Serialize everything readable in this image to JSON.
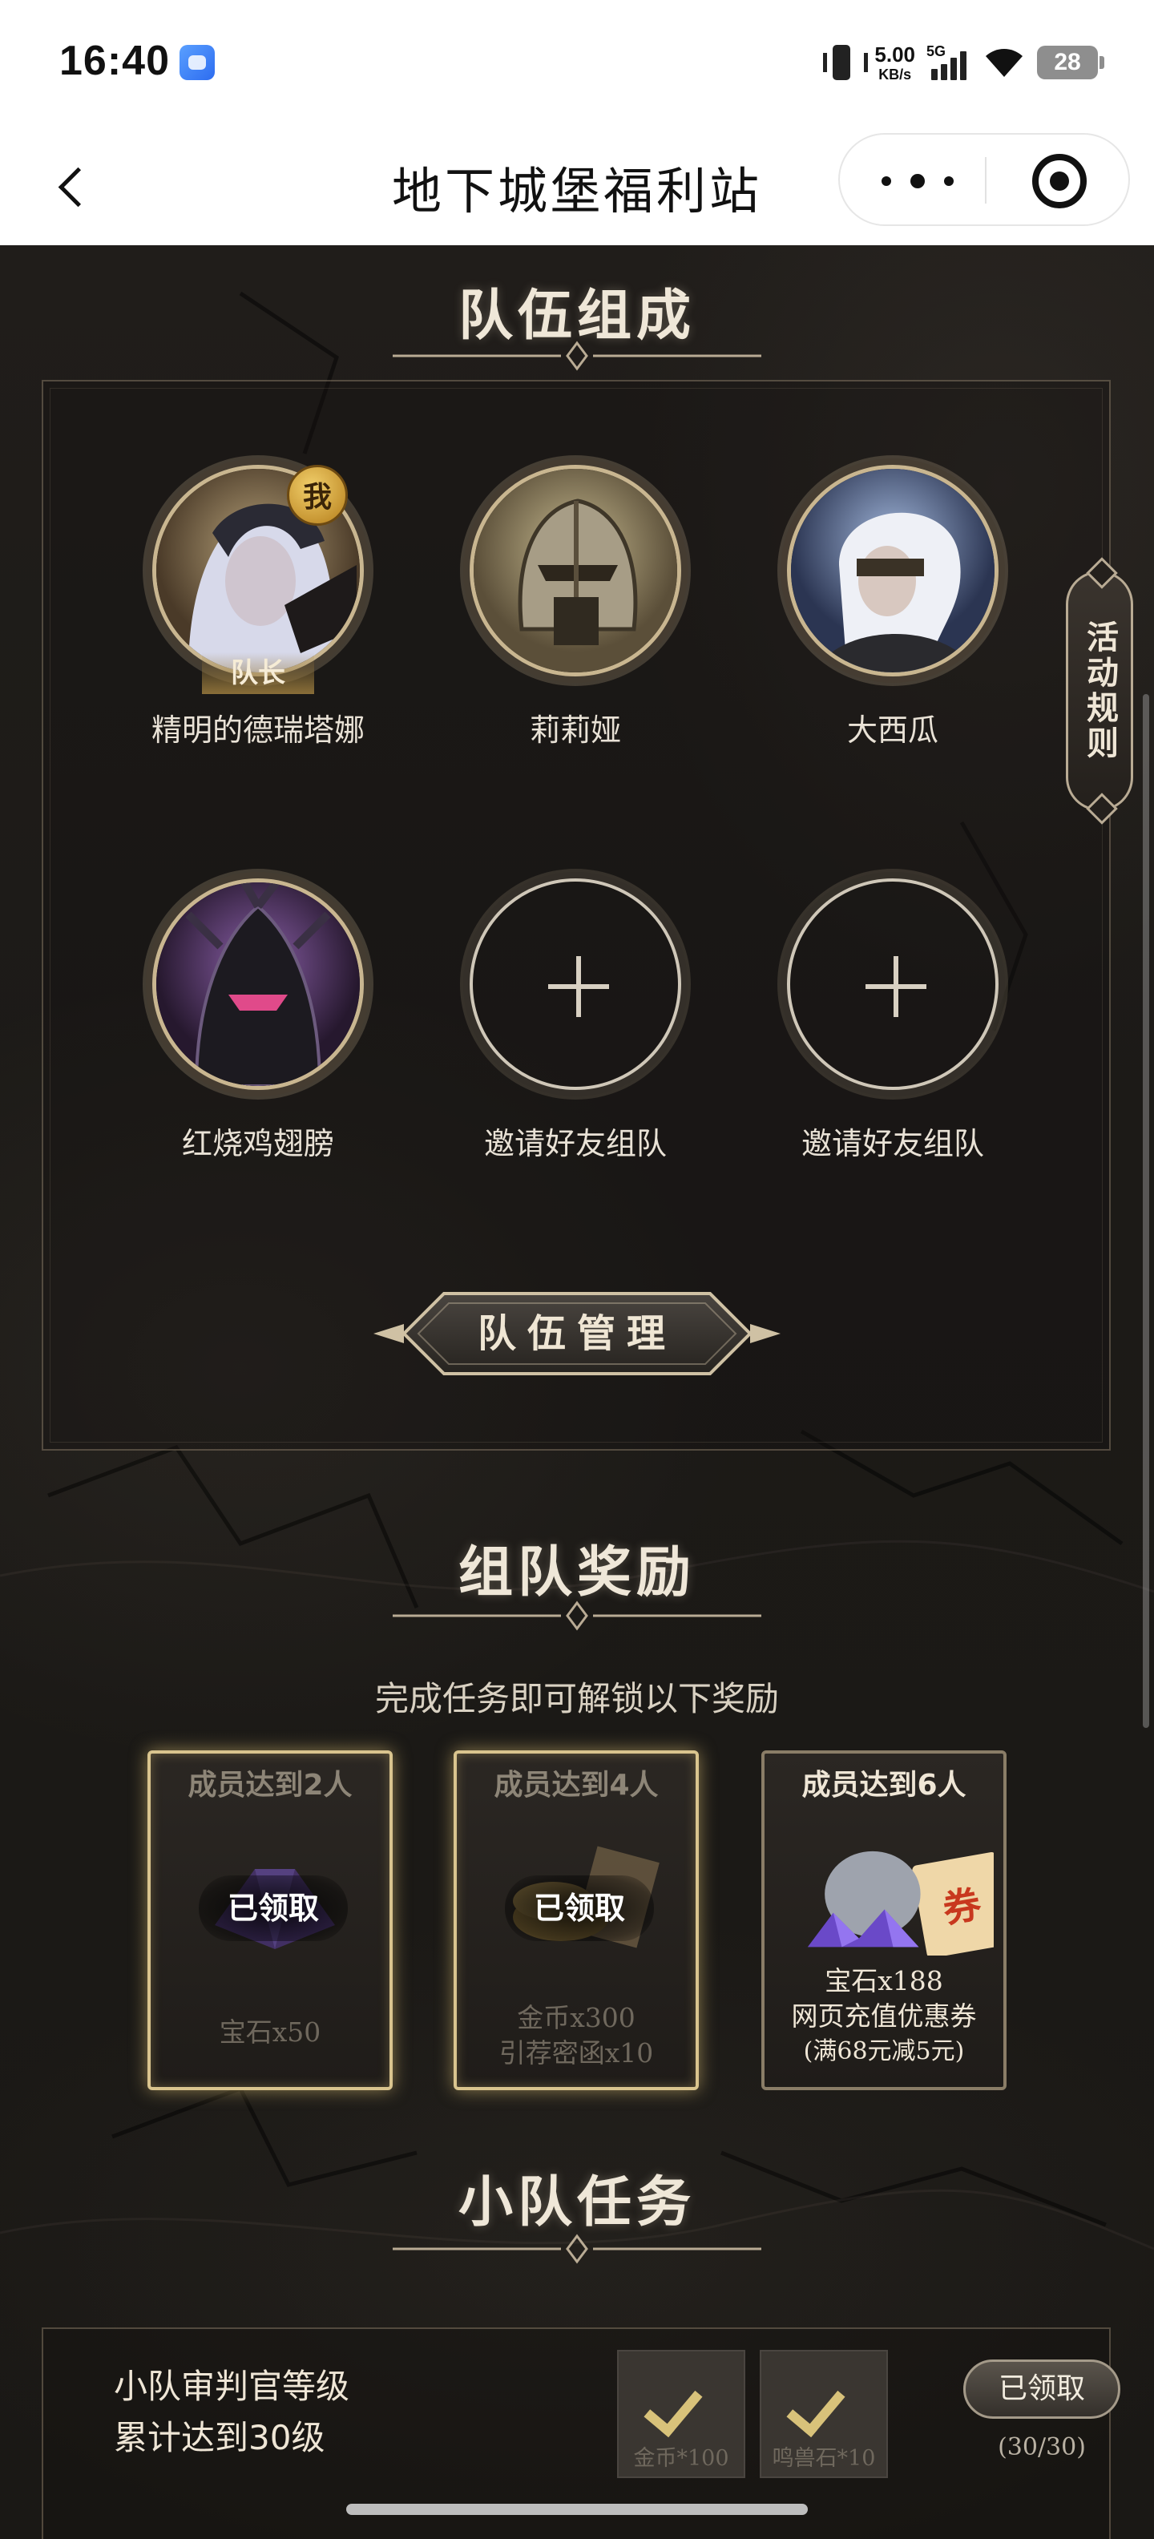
{
  "status_bar": {
    "time": "16:40",
    "net_speed": "5.00",
    "net_unit": "KB/s",
    "signal_label": "5G",
    "battery": "28",
    "icons": [
      "app-icon",
      "vibrate-icon",
      "signal-icon",
      "wifi-icon",
      "battery-icon"
    ]
  },
  "nav": {
    "title": "地下城堡福利站",
    "icons": [
      "back-icon",
      "more-icon",
      "close-mini-icon"
    ]
  },
  "rules_tab": "活动规则",
  "team": {
    "title": "队伍组成",
    "me_badge": "我",
    "leader_badge": "队长",
    "members": [
      {
        "name": "精明的德瑞塔娜",
        "avatar": "silver-haired-woman"
      },
      {
        "name": "莉莉娅",
        "avatar": "knight-helmet"
      },
      {
        "name": "大西瓜",
        "avatar": "masked-white-haired-warrior"
      },
      {
        "name": "红烧鸡翅膀",
        "avatar": "dark-armored-knight"
      }
    ],
    "invite_label": "邀请好友组队",
    "manage_button": "队伍管理"
  },
  "rewards": {
    "title": "组队奖励",
    "subtitle": "完成任务即可解锁以下奖励",
    "claimed_label": "已领取",
    "cards": [
      {
        "title": "成员达到2人",
        "lines": [
          "宝石x50"
        ],
        "claimed": true,
        "art": "purple-gems"
      },
      {
        "title": "成员达到4人",
        "lines": [
          "金币x300",
          "引荐密函x10"
        ],
        "claimed": true,
        "art": "gold-coins-scroll"
      },
      {
        "title": "成员达到6人",
        "lines": [
          "宝石x188",
          "网页充值优惠券",
          "(满68元减5元)"
        ],
        "claimed": false,
        "art": "gem-bag-coupon",
        "coupon_char": "券"
      }
    ],
    "colors": {
      "claimed_glow": "#d9c48e",
      "card_border": "#8a7d67"
    }
  },
  "tasks": {
    "title": "小队任务",
    "items": [
      {
        "desc_line1": "小队审判官等级",
        "desc_line2": "累计达到30级",
        "rewards": [
          "金币*100",
          "鸣兽石*10"
        ],
        "button": "已领取",
        "progress": "(30/30)"
      }
    ]
  }
}
